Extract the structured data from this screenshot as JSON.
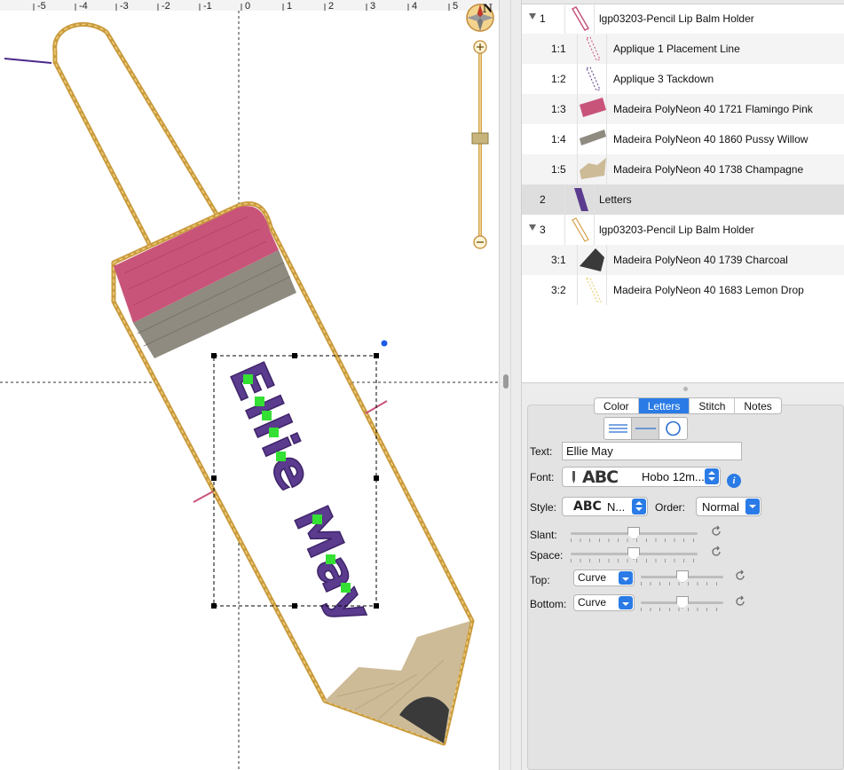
{
  "canvas": {
    "ruler_ticks": [
      "-5",
      "-4",
      "-3",
      "-2",
      "-1",
      "0",
      "1",
      "2",
      "3",
      "4",
      "5"
    ],
    "compass_label": "N",
    "embroidered_text": "Ellie May"
  },
  "object_list": {
    "rows": [
      {
        "num": "1",
        "label": "lgp03203-Pencil Lip Balm Holder",
        "group": true
      },
      {
        "num": "1:1",
        "label": "Applique 1 Placement Line"
      },
      {
        "num": "1:2",
        "label": "Applique 3 Tackdown"
      },
      {
        "num": "1:3",
        "label": "Madeira PolyNeon 40 1721 Flamingo Pink"
      },
      {
        "num": "1:4",
        "label": "Madeira PolyNeon 40 1860 Pussy Willow"
      },
      {
        "num": "1:5",
        "label": "Madeira PolyNeon 40 1738 Champagne"
      },
      {
        "num": "2",
        "label": "Letters",
        "selected": true
      },
      {
        "num": "3",
        "label": "lgp03203-Pencil Lip Balm Holder",
        "group": true
      },
      {
        "num": "3:1",
        "label": "Madeira PolyNeon 40 1739 Charcoal"
      },
      {
        "num": "3:2",
        "label": "Madeira PolyNeon 40 1683 Lemon Drop"
      }
    ]
  },
  "properties": {
    "tabs": [
      "Color",
      "Letters",
      "Stitch",
      "Notes"
    ],
    "active_tab": "Letters",
    "text_label": "Text:",
    "text_value": "Ellie May",
    "font_label": "Font:",
    "font_preview": "ABC",
    "font_value": "Hobo 12m...",
    "style_label": "Style:",
    "style_preview": "ABC",
    "style_value": "N...",
    "order_label": "Order:",
    "order_value": "Normal",
    "slant_label": "Slant:",
    "space_label": "Space:",
    "top_label": "Top:",
    "top_value": "Curve",
    "bottom_label": "Bottom:",
    "bottom_value": "Curve"
  },
  "colors": {
    "accent": "#2a7be6",
    "thread_pink": "#c9547a",
    "thread_grey": "#8f8b80",
    "thread_champagne": "#cdbb98",
    "thread_charcoal": "#3a3a3a",
    "thread_gold": "#d4a24a",
    "letters_purple": "#5a3b8e"
  }
}
